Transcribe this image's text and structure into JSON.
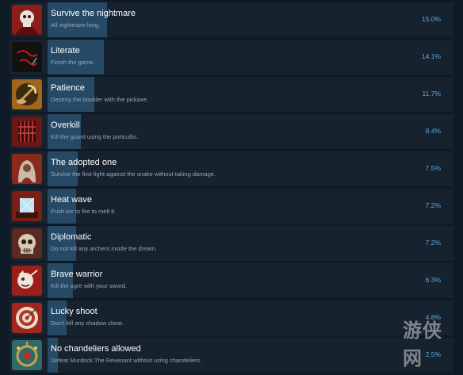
{
  "achievements": [
    {
      "title": "Survive the nightmare",
      "description": "All nightmare long.",
      "percent": "15.0%",
      "icon": "skull-portrait-icon",
      "fraction": 0.15,
      "icon_bg": "#8b1d1b"
    },
    {
      "title": "Literate",
      "description": "Finish the game.",
      "percent": "14.1%",
      "icon": "the-end-script-icon",
      "fraction": 0.141,
      "icon_bg": "#111111",
      "icon_text": "The End"
    },
    {
      "title": "Patience",
      "description": "Destroy the boulder with the pickaxe.",
      "percent": "11.7%",
      "icon": "pickaxe-icon",
      "fraction": 0.117,
      "icon_bg": "#a0661b"
    },
    {
      "title": "Overkill",
      "description": "Kill the guard using the portcullis.",
      "percent": "8.4%",
      "icon": "portcullis-icon",
      "fraction": 0.084,
      "icon_bg": "#6b1716"
    },
    {
      "title": "The adopted one",
      "description": "Survive the first fight against the snake without taking damage.",
      "percent": "7.5%",
      "icon": "hooded-figure-icon",
      "fraction": 0.075,
      "icon_bg": "#8a2a1c"
    },
    {
      "title": "Heat wave",
      "description": "Push ice to fire to melt it.",
      "percent": "7.2%",
      "icon": "ice-block-icon",
      "fraction": 0.072,
      "icon_bg": "#7a1f18"
    },
    {
      "title": "Diplomatic",
      "description": "Do not kill any archers inside the dream.",
      "percent": "7.2%",
      "icon": "skull-mask-icon",
      "fraction": 0.072,
      "icon_bg": "#5b2a22"
    },
    {
      "title": "Brave warrior",
      "description": "Kill the ogre with your sword.",
      "percent": "6.3%",
      "icon": "ogre-icon",
      "fraction": 0.063,
      "icon_bg": "#9a1e1a"
    },
    {
      "title": "Lucky shoot",
      "description": "Don't kill any shadow clone.",
      "percent": "4.8%",
      "icon": "target-icon",
      "fraction": 0.048,
      "icon_bg": "#a0261e"
    },
    {
      "title": "No chandeliers allowed",
      "description": "Defeat Murdock The Revenant without using chandeliers.",
      "percent": "2.5%",
      "icon": "chandelier-icon",
      "fraction": 0.025,
      "icon_bg": "#2f6a6a"
    }
  ],
  "watermark": {
    "text": "游侠网"
  },
  "colors": {
    "page_bg": "#0e1a26",
    "row_bg": "#16222e",
    "bar": "#264a66",
    "percent": "#5fa6dd"
  }
}
